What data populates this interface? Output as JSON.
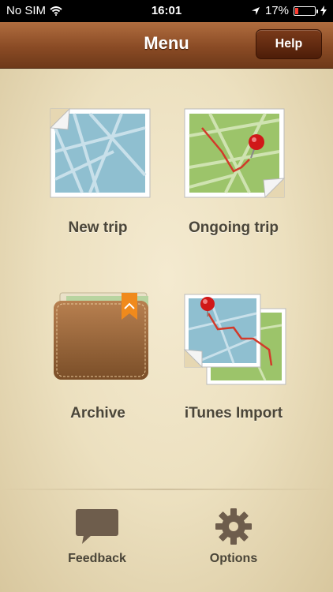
{
  "status_bar": {
    "carrier": "No SIM",
    "time": "16:01",
    "battery": "17%",
    "battery_level": 0.17
  },
  "navbar": {
    "title": "Menu",
    "help_label": "Help"
  },
  "menu": {
    "items": [
      {
        "label": "New trip",
        "icon": "map-icon"
      },
      {
        "label": "Ongoing trip",
        "icon": "route-map-icon"
      },
      {
        "label": "Archive",
        "icon": "wallet-icon"
      },
      {
        "label": "iTunes Import",
        "icon": "import-maps-icon"
      }
    ]
  },
  "bottom": {
    "feedback_label": "Feedback",
    "options_label": "Options"
  },
  "colors": {
    "nav": "#8a4b25",
    "accent_pin": "#d01818",
    "route": "#d23a2a",
    "map_blue": "#8fbfd0",
    "map_green": "#9cc46a"
  }
}
